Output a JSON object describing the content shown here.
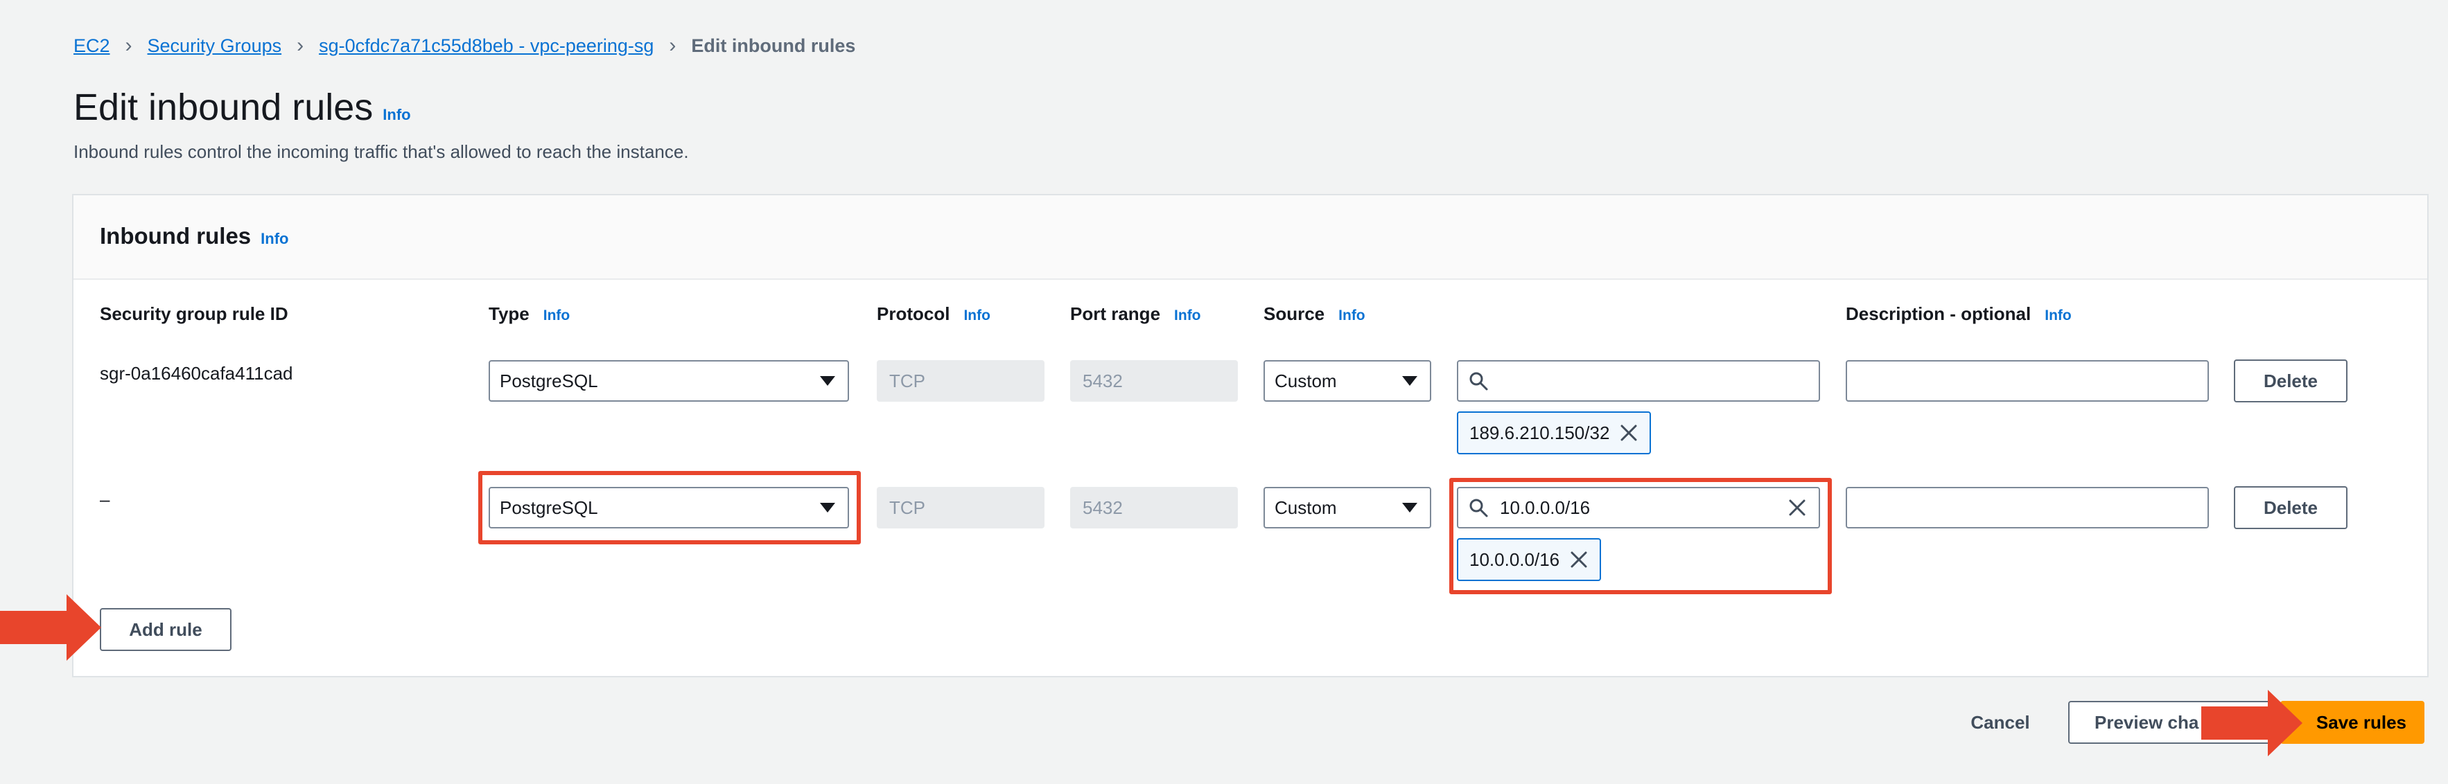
{
  "breadcrumb": {
    "items": [
      "EC2",
      "Security Groups",
      "sg-0cfdc7a71c55d8beb - vpc-peering-sg"
    ],
    "current": "Edit inbound rules"
  },
  "page": {
    "title": "Edit inbound rules",
    "info": "Info",
    "description": "Inbound rules control the incoming traffic that's allowed to reach the instance."
  },
  "panel": {
    "title": "Inbound rules",
    "info": "Info",
    "columns": {
      "rule_id": "Security group rule ID",
      "type": "Type",
      "protocol": "Protocol",
      "port_range": "Port range",
      "source": "Source",
      "description": "Description - optional",
      "info": "Info"
    },
    "rows": [
      {
        "rule_id": "sgr-0a16460cafa411cad",
        "type": "PostgreSQL",
        "protocol": "TCP",
        "port_range": "5432",
        "source": "Custom",
        "search_value": "",
        "token": "189.6.210.150/32",
        "description": "",
        "delete_label": "Delete"
      },
      {
        "rule_id": "–",
        "type": "PostgreSQL",
        "protocol": "TCP",
        "port_range": "5432",
        "source": "Custom",
        "search_value": "10.0.0.0/16",
        "token": "10.0.0.0/16",
        "description": "",
        "delete_label": "Delete"
      }
    ],
    "add_rule_label": "Add rule"
  },
  "footer": {
    "cancel": "Cancel",
    "preview": "Preview cha",
    "save": "Save rules"
  },
  "colors": {
    "accent": "#0972d3",
    "highlight": "#e8452c",
    "primary_button": "#ff9900"
  }
}
